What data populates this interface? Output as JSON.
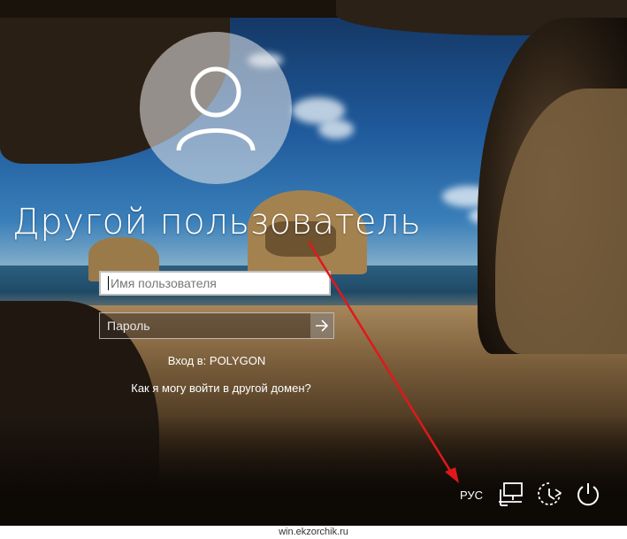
{
  "login": {
    "title": "Другой пользователь",
    "username_placeholder": "Имя пользователя",
    "password_placeholder": "Пароль",
    "submit_icon": "arrow-right-icon",
    "signin_to": "Вход в: POLYGON",
    "other_domain_link": "Как я могу войти в другой домен?"
  },
  "tray": {
    "language": "РУС",
    "icons": [
      "network-icon",
      "accessibility-icon",
      "power-icon"
    ]
  },
  "annotation": {
    "arrow_color": "#e0181b"
  },
  "watermark": "win.ekzorchik.ru"
}
